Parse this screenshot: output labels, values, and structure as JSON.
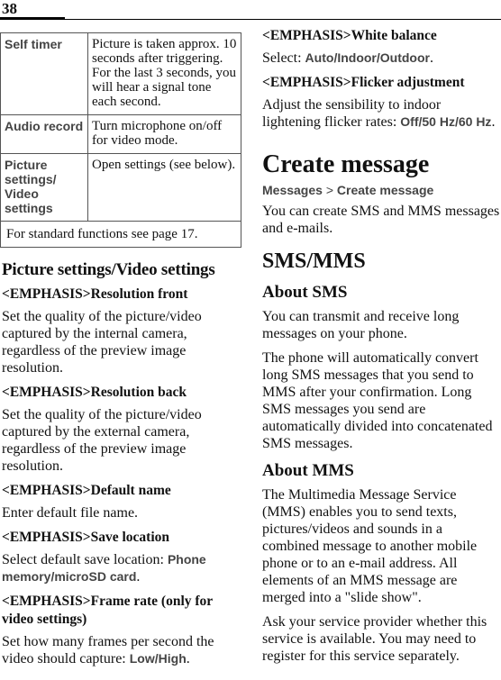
{
  "page": {
    "number": "38"
  },
  "function_table": {
    "rows": [
      {
        "key": "Self timer",
        "value": "Picture is taken approx. 10 seconds after triggering. For the last 3 seconds, you will hear a signal tone each second."
      },
      {
        "key": "Audio record",
        "value": "Turn microphone on/off for video mode."
      },
      {
        "key": "Picture settings/ Video settings",
        "value": "Open settings (see below)."
      }
    ],
    "footer": "For standard functions see page 17."
  },
  "picture_settings": {
    "heading": "Picture settings/Video settings",
    "items": [
      {
        "title": "<EMPHASIS>Resolution front",
        "text": "Set the quality of the picture/video captured by the internal camera, regardless of the preview image resolution."
      },
      {
        "title": "<EMPHASIS>Resolution back",
        "text": "Set the quality of the picture/video captured by the external camera, regardless of the preview image resolution."
      },
      {
        "title": "<EMPHASIS>Default name",
        "text": "Enter default file name."
      }
    ],
    "save_location": {
      "title": "<EMPHASIS>Save location",
      "text_prefix": "Select default save location: ",
      "options": [
        "Phone memory",
        "microSD card"
      ],
      "text_suffix": "."
    },
    "frame_rate": {
      "title": "<EMPHASIS>Frame rate (only for video settings)",
      "text_prefix": "Set how many frames per second the video should capture: ",
      "options": [
        "Low",
        "High"
      ],
      "text_suffix": "."
    },
    "white_balance": {
      "title": "<EMPHASIS>White balance",
      "text_prefix": "Select: ",
      "options": [
        "Auto",
        "Indoor",
        "Outdoor"
      ],
      "text_suffix": "."
    },
    "flicker": {
      "title": "<EMPHASIS>Flicker adjustment",
      "text_prefix": "Adjust the sensibility to indoor lightening flicker rates: ",
      "options": [
        "Off",
        "50 Hz",
        "60 Hz"
      ],
      "text_suffix": "."
    }
  },
  "create_message": {
    "heading": "Create message",
    "breadcrumb": [
      "Messages",
      "Create message"
    ],
    "breadcrumb_separator": ">",
    "intro": "You can create SMS and MMS messages and e-mails.",
    "sms_mms_heading": "SMS/MMS",
    "about_sms": {
      "heading": "About SMS",
      "paragraphs": [
        "You can transmit and receive long messages on your phone.",
        "The phone will automatically convert long SMS messages that you send to MMS after your confirmation. Long SMS messages you send are automatically divided into concatenated SMS messages."
      ]
    },
    "about_mms": {
      "heading": "About MMS",
      "paragraphs": [
        "The Multimedia Message Service (MMS) enables you to send texts, pictures/videos and sounds in a combined message to another mobile phone or to an e-mail address. All elements of an MMS message are merged into a \"slide show\".",
        "Ask your service provider whether this service is available. You may need to register for this service separately."
      ]
    }
  }
}
